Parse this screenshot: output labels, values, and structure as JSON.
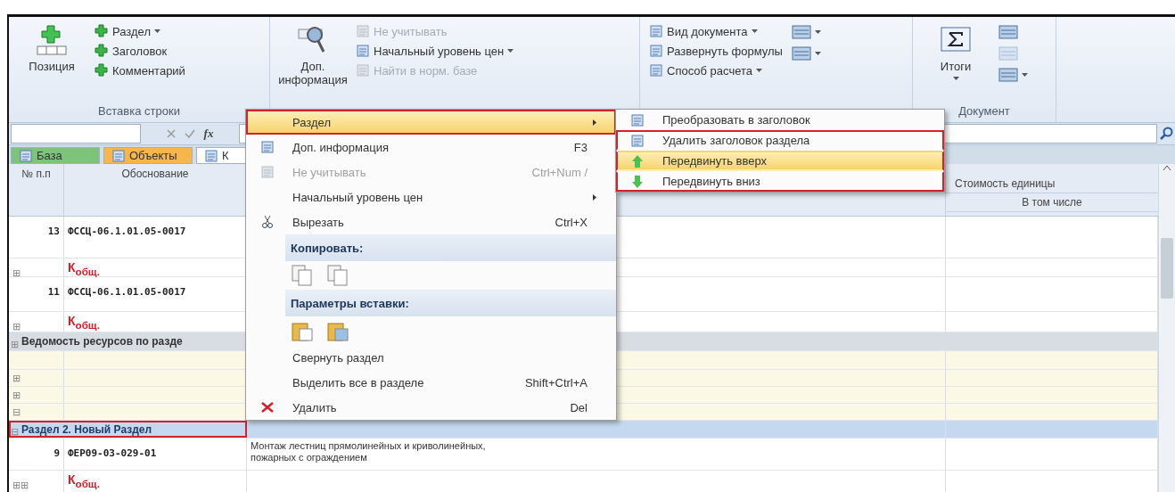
{
  "ribbon": {
    "groups": [
      {
        "label": "Вставка строки",
        "large": {
          "label": "Позиция",
          "dropdown": false
        },
        "small": [
          {
            "label": "Раздел",
            "dropdown": true,
            "disabled": false
          },
          {
            "label": "Заголовок",
            "dropdown": false,
            "disabled": false
          },
          {
            "label": "Комментарий",
            "dropdown": false,
            "disabled": false
          }
        ]
      },
      {
        "large": {
          "label": "Доп. информация",
          "dropdown": false
        },
        "small": [
          {
            "label": "Не учитывать",
            "dropdown": false,
            "disabled": true
          },
          {
            "label": "Начальный уровень цен",
            "dropdown": true,
            "disabled": false
          },
          {
            "label": "Найти в норм. базе",
            "dropdown": false,
            "disabled": true
          }
        ]
      },
      {
        "small": [
          {
            "label": "Вид документа",
            "dropdown": true,
            "disabled": false
          },
          {
            "label": "Развернуть формулы",
            "dropdown": false,
            "disabled": false
          },
          {
            "label": "Способ расчета",
            "dropdown": true,
            "disabled": false
          }
        ],
        "icon_buttons": [
          {
            "dropdown": true,
            "disabled": false
          },
          {
            "dropdown": true,
            "disabled": false
          }
        ]
      },
      {
        "label": "Документ",
        "large": {
          "label": "Итоги",
          "dropdown": true
        },
        "icon_buttons": [
          {
            "dropdown": false,
            "disabled": false
          },
          {
            "dropdown": false,
            "disabled": true
          },
          {
            "dropdown": true,
            "disabled": false
          }
        ]
      }
    ]
  },
  "formula_bar": {
    "function_symbol": "fx"
  },
  "tabs": [
    {
      "label": "База",
      "color": "#7cc47a"
    },
    {
      "label": "Объекты",
      "color": "#f6b64c"
    },
    {
      "label": "К",
      "color": "#ffffff"
    }
  ],
  "table": {
    "columns": [
      "№ п.п",
      "Обоснование"
    ],
    "right_header": {
      "title": "Стоимость единицы",
      "subtitle": "В том числе"
    },
    "rows": [
      {
        "kind": "position",
        "number": "13",
        "code": "ФССЦ-06.1.01.05-0017"
      },
      {
        "kind": "coef",
        "expanders": [
          "⊞"
        ],
        "label": "К$_{общ.}$"
      },
      {
        "kind": "position",
        "number": "11",
        "code": "ФССЦ-06.1.01.05-0017"
      },
      {
        "kind": "coef",
        "expanders": [
          "⊞"
        ],
        "label": "К$_{общ.}$"
      },
      {
        "kind": "group",
        "expander": "⊞",
        "label": "Ведомость ресурсов по разде"
      },
      {
        "kind": "blank",
        "expanders": []
      },
      {
        "kind": "blank",
        "expanders": [
          "⊞"
        ]
      },
      {
        "kind": "blank",
        "expanders": [
          "⊞"
        ]
      },
      {
        "kind": "blank",
        "expanders": [
          "⊟"
        ]
      },
      {
        "kind": "section",
        "expander": "⊟",
        "label": "Раздел 2. Новый Раздел",
        "highlighted": true
      },
      {
        "kind": "position",
        "number": "9",
        "code": "ФЕР09-03-029-01",
        "description": "Монтаж лестниц прямолинейных и криволинейных, пожарных с ограждением"
      },
      {
        "kind": "coef",
        "expanders": [
          "⊞",
          "⊞"
        ],
        "label": "К$_{общ.}$"
      }
    ]
  },
  "context_menu": {
    "items": [
      {
        "kind": "item",
        "label": "Раздел",
        "submenu": true,
        "selected": true,
        "highlighted": true,
        "disabled": false
      },
      {
        "kind": "item",
        "label": "Доп. информация",
        "shortcut": "F3",
        "submenu": false,
        "selected": false,
        "highlighted": false,
        "disabled": false
      },
      {
        "kind": "item",
        "label": "Не учитывать",
        "shortcut": "Ctrl+Num /",
        "submenu": false,
        "selected": false,
        "highlighted": false,
        "disabled": true
      },
      {
        "kind": "item",
        "label": "Начальный уровень цен",
        "submenu": true,
        "selected": false,
        "highlighted": false,
        "disabled": false
      },
      {
        "kind": "item",
        "label": "Вырезать",
        "shortcut": "Ctrl+X",
        "submenu": false,
        "selected": false,
        "highlighted": false,
        "disabled": false
      },
      {
        "kind": "header",
        "label": "Копировать:"
      },
      {
        "kind": "icons"
      },
      {
        "kind": "header",
        "label": "Параметры вставки:"
      },
      {
        "kind": "icons"
      },
      {
        "kind": "item",
        "label": "Свернуть раздел",
        "submenu": false,
        "selected": false,
        "highlighted": false,
        "disabled": false
      },
      {
        "kind": "item",
        "label": "Выделить все в разделе",
        "shortcut": "Shift+Ctrl+A",
        "submenu": false,
        "selected": false,
        "highlighted": false,
        "disabled": false
      },
      {
        "kind": "item",
        "label": "Удалить",
        "shortcut": "Del",
        "submenu": false,
        "selected": false,
        "highlighted": false,
        "disabled": false
      }
    ]
  },
  "submenu": {
    "items": [
      {
        "label": "Преобразовать в заголовок",
        "selected": false,
        "highlighted": false
      },
      {
        "label": "Удалить заголовок раздела",
        "selected": false,
        "highlighted": true
      },
      {
        "label": "Передвинуть вверх",
        "selected": true,
        "highlighted": true
      },
      {
        "label": "Передвинуть вниз",
        "selected": false,
        "highlighted": true
      }
    ]
  }
}
